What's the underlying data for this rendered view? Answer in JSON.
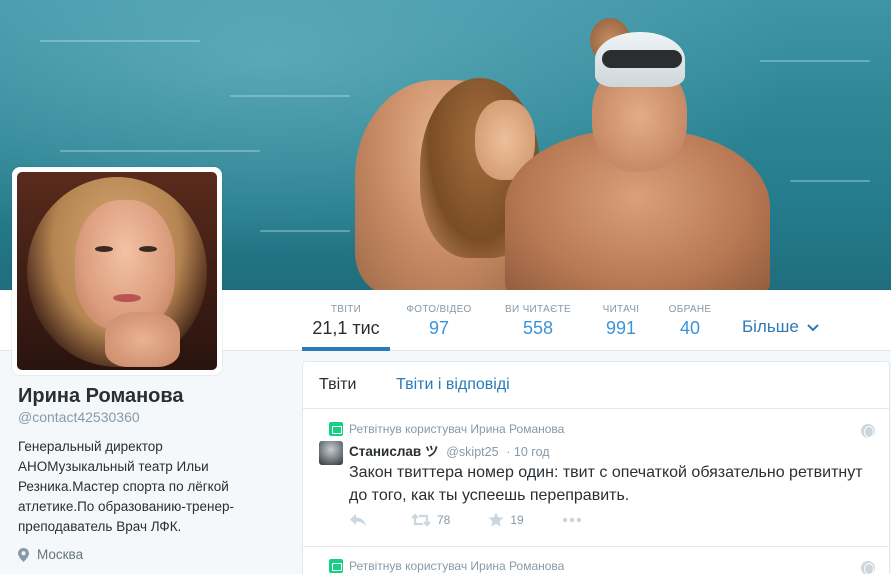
{
  "profile": {
    "name": "Ирина Романова",
    "handle": "@contact42530360",
    "bio": "Генеральный директор АНОМузыкальный театр Ильи Резника.Мастер спорта по лёгкой атлетике.По образованию-тренер-преподаватель Врач ЛФК.",
    "location": "Москва"
  },
  "nav": {
    "stats": [
      {
        "label": "ТВІТИ",
        "value": "21,1 тис"
      },
      {
        "label": "ФОТО/ВІДЕО",
        "value": "97"
      },
      {
        "label": "ВИ ЧИТАЄТЕ",
        "value": "558"
      },
      {
        "label": "ЧИТАЧІ",
        "value": "991"
      },
      {
        "label": "ОБРАНЕ",
        "value": "40"
      }
    ],
    "more_label": "Більше"
  },
  "timeline": {
    "tabs": [
      "Твіти",
      "Твіти і відповіді"
    ],
    "tweets": [
      {
        "retweet_line": "Ретвітнув користувач Ирина Романова",
        "author_name": "Станислав ツ",
        "author_handle": "@skipt25",
        "time": "· 10 год",
        "text": "Закон твиттера номер один: твит с опечаткой обязательно ретвитнут до того, как ты успеешь переправить.",
        "retweets": "78",
        "favorites": "19"
      },
      {
        "retweet_line": "Ретвітнув користувач Ирина Романова"
      }
    ]
  },
  "colors": {
    "link": "#2b7bb9",
    "stat_value": "#3b94d9",
    "muted": "#8899a6",
    "retweet_green": "#19cf86"
  }
}
